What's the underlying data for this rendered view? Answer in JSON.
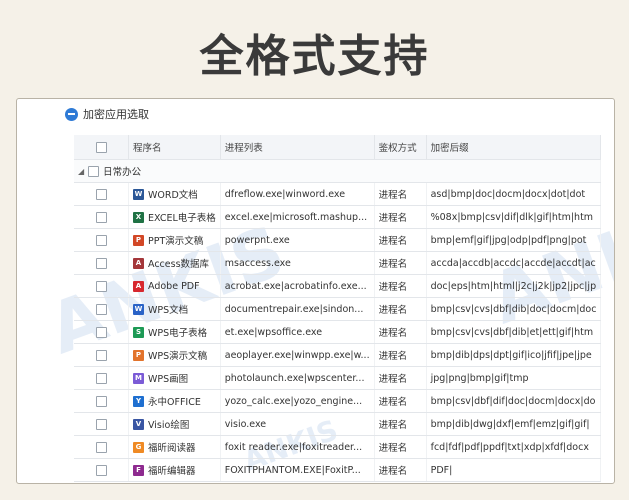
{
  "headline": "全格式支持",
  "window": {
    "title": "加密应用选取"
  },
  "table": {
    "headers": [
      "程序名",
      "进程列表",
      "鉴权方式",
      "加密后缀"
    ],
    "group": "日常办公",
    "rows": [
      {
        "name": "WORD文档",
        "process": "dfreflow.exe|winword.exe",
        "auth": "进程名",
        "ext": "asd|bmp|doc|docm|docx|dot|dot",
        "icon": "word-icon",
        "color": "#2b5797",
        "glyph": "W"
      },
      {
        "name": "EXCEL电子表格",
        "process": "excel.exe|microsoft.mashup...",
        "auth": "进程名",
        "ext": "%08x|bmp|csv|dif|dlk|gif|htm|htm",
        "icon": "excel-icon",
        "color": "#1f7244",
        "glyph": "X"
      },
      {
        "name": "PPT演示文稿",
        "process": "powerpnt.exe",
        "auth": "进程名",
        "ext": "bmp|emf|gif|jpg|odp|pdf|png|pot",
        "icon": "powerpoint-icon",
        "color": "#d24726",
        "glyph": "P"
      },
      {
        "name": "Access数据库",
        "process": "msaccess.exe",
        "auth": "进程名",
        "ext": "accda|accdb|accdc|accde|accdt|ac",
        "icon": "access-icon",
        "color": "#a4373a",
        "glyph": "A"
      },
      {
        "name": "Adobe PDF",
        "process": "acrobat.exe|acrobatinfo.exe...",
        "auth": "进程名",
        "ext": "doc|eps|htm|html|j2c|j2k|jp2|jpc|jp",
        "icon": "adobe-pdf-icon",
        "color": "#d7282f",
        "glyph": "A"
      },
      {
        "name": "WPS文档",
        "process": "documentrepair.exe|sindon...",
        "auth": "进程名",
        "ext": "bmp|csv|cvs|dbf|dib|doc|docm|doc",
        "icon": "wps-writer-icon",
        "color": "#2a63c7",
        "glyph": "W"
      },
      {
        "name": "WPS电子表格",
        "process": "et.exe|wpsoffice.exe",
        "auth": "进程名",
        "ext": "bmp|csv|cvs|dbf|dib|et|ett|gif|htm",
        "icon": "wps-sheet-icon",
        "color": "#1d9a55",
        "glyph": "S"
      },
      {
        "name": "WPS演示文稿",
        "process": "aeoplayer.exe|winwpp.exe|w...",
        "auth": "进程名",
        "ext": "bmp|dib|dps|dpt|gif|ico|jfif|jpe|jpe",
        "icon": "wps-present-icon",
        "color": "#e2732b",
        "glyph": "P"
      },
      {
        "name": "WPS画图",
        "process": "photolaunch.exe|wpscenter...",
        "auth": "进程名",
        "ext": "jpg|png|bmp|gif|tmp",
        "icon": "wps-paint-icon",
        "color": "#7b5bd6",
        "glyph": "M"
      },
      {
        "name": "永中OFFICE",
        "process": "yozo_calc.exe|yozo_engine...",
        "auth": "进程名",
        "ext": "bmp|csv|dbf|dif|doc|docm|docx|do",
        "icon": "yozo-office-icon",
        "color": "#1e6fd0",
        "glyph": "Y"
      },
      {
        "name": "Visio绘图",
        "process": "visio.exe",
        "auth": "进程名",
        "ext": "bmp|dib|dwg|dxf|emf|emz|gif|gif|",
        "icon": "visio-icon",
        "color": "#3955a3",
        "glyph": "V"
      },
      {
        "name": "福昕阅读器",
        "process": "foxit reader.exe|foxitreader...",
        "auth": "进程名",
        "ext": "fcd|fdf|pdf|ppdf|txt|xdp|xfdf|docx",
        "icon": "foxit-reader-icon",
        "color": "#ef8a24",
        "glyph": "G"
      },
      {
        "name": "福昕编辑器",
        "process": "FOXITPHANTOM.EXE|FoxitP...",
        "auth": "进程名",
        "ext": "PDF|",
        "icon": "foxit-editor-icon",
        "color": "#8e2a8f",
        "glyph": "F"
      }
    ]
  },
  "watermark": "ANKIS"
}
